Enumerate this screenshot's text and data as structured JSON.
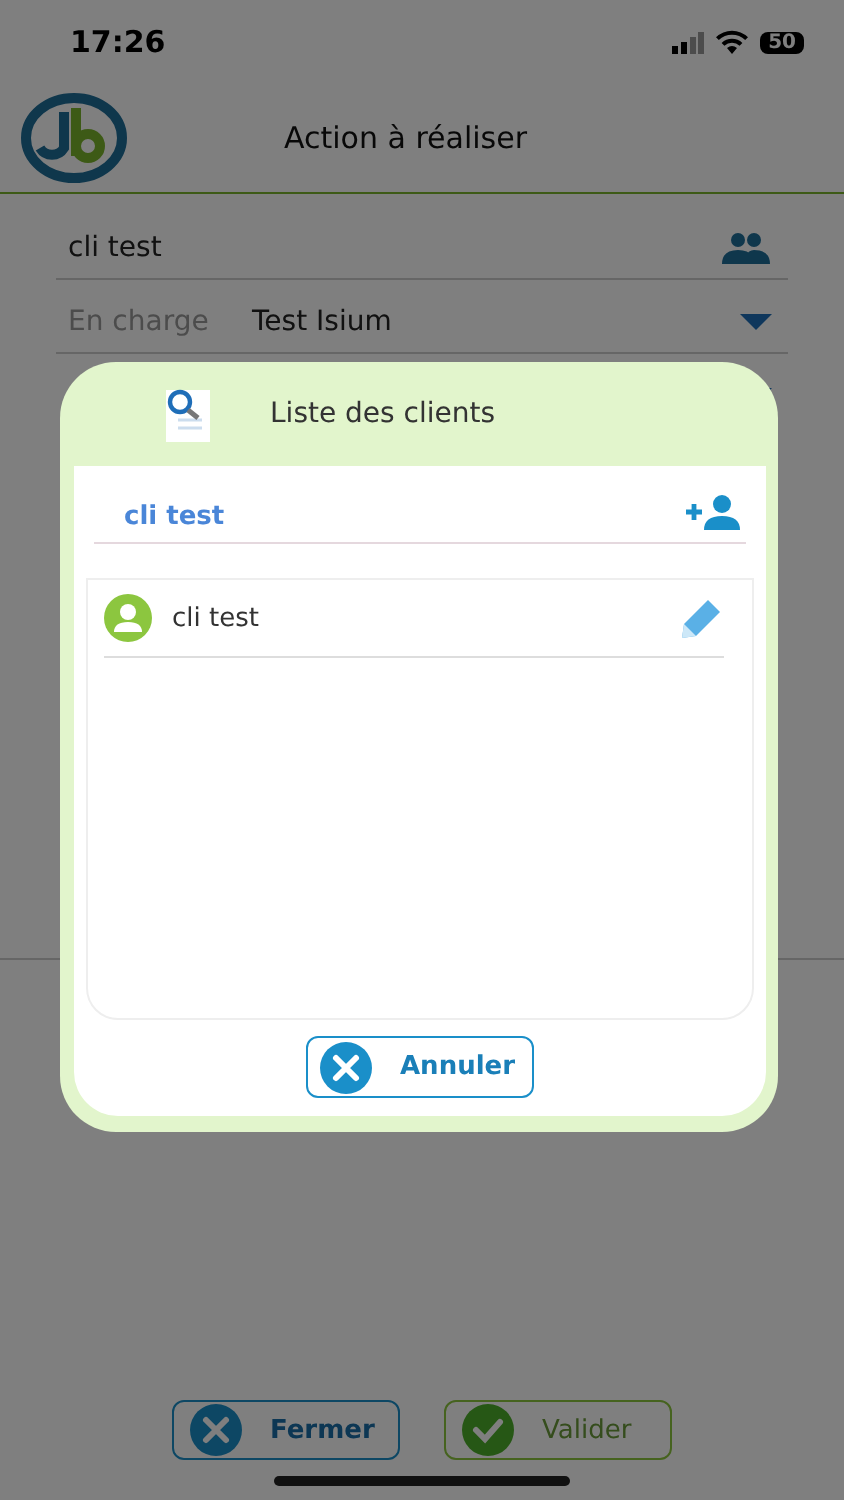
{
  "status_bar": {
    "time": "17:26",
    "battery": "50"
  },
  "header": {
    "title": "Action à réaliser"
  },
  "form": {
    "client": "cli test",
    "fields": [
      {
        "label": "En charge",
        "value": "Test Isium"
      }
    ]
  },
  "dialog": {
    "title": "Liste des clients",
    "search": {
      "value": "cli test"
    },
    "clients": [
      {
        "name": "cli test"
      }
    ],
    "cancel": "Annuler"
  },
  "footer": {
    "buttons": [
      {
        "kind": "close",
        "label": "Fermer"
      },
      {
        "kind": "validate",
        "label": "Valider"
      }
    ]
  }
}
